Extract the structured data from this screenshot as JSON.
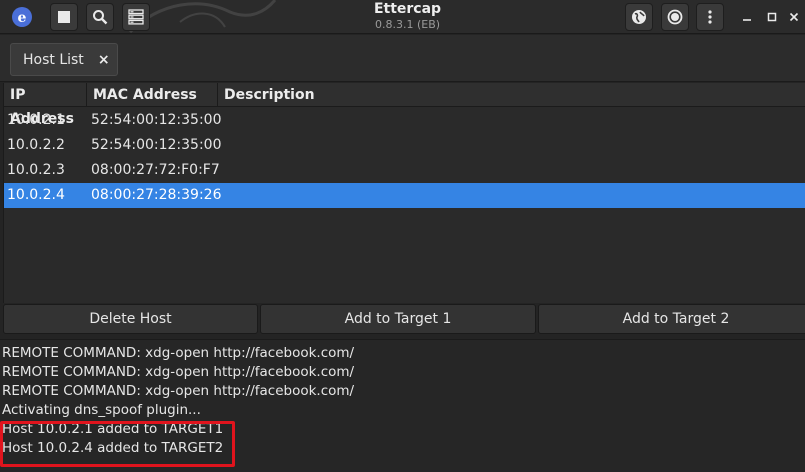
{
  "window": {
    "title": "Ettercap",
    "subtitle": "0.8.3.1 (EB)"
  },
  "header": {
    "left_buttons": [
      "stop-icon",
      "search-icon",
      "server-list-icon"
    ],
    "right_buttons": [
      "globe-icon",
      "record-icon",
      "kebab-menu-icon"
    ]
  },
  "tabs": [
    {
      "label": "Host List",
      "close": "×"
    }
  ],
  "host_table": {
    "columns": [
      "IP Address",
      "MAC Address",
      "Description"
    ],
    "rows": [
      {
        "ip": "10.0.2.1",
        "mac": "52:54:00:12:35:00",
        "desc": ""
      },
      {
        "ip": "10.0.2.2",
        "mac": "52:54:00:12:35:00",
        "desc": ""
      },
      {
        "ip": "10.0.2.3",
        "mac": "08:00:27:72:F0:F7",
        "desc": ""
      },
      {
        "ip": "10.0.2.4",
        "mac": "08:00:27:28:39:26",
        "desc": ""
      }
    ],
    "selected_index": 3
  },
  "buttons": {
    "delete": "Delete Host",
    "target1": "Add to Target 1",
    "target2": "Add to Target 2"
  },
  "log": [
    "REMOTE COMMAND: xdg-open http://facebook.com/",
    "REMOTE COMMAND: xdg-open http://facebook.com/",
    "REMOTE COMMAND: xdg-open http://facebook.com/",
    "Activating dns_spoof plugin...",
    "Host 10.0.2.1 added to TARGET1",
    "Host 10.0.2.4 added to TARGET2"
  ],
  "colors": {
    "selection": "#3584e4",
    "highlight_box": "#e0141d",
    "logo": "#4a6fd8"
  }
}
